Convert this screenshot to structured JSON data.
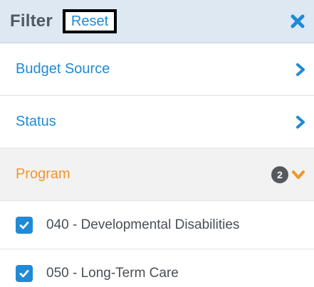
{
  "header": {
    "title": "Filter",
    "reset_label": "Reset",
    "close_icon": "close-icon"
  },
  "sections": [
    {
      "label": "Budget Source",
      "state": "collapsed",
      "icon": "chevron-right-icon"
    },
    {
      "label": "Status",
      "state": "collapsed",
      "icon": "chevron-right-icon"
    },
    {
      "label": "Program",
      "state": "expanded",
      "icon": "chevron-down-icon",
      "selected_count": "2"
    }
  ],
  "program_options": [
    {
      "label": "040 - Developmental Disabilities",
      "checked": true
    },
    {
      "label": "050 - Long-Term Care",
      "checked": true
    }
  ],
  "colors": {
    "accent": "#1f8ad6",
    "active_section": "#f0962b",
    "header_bg": "#dde8f2",
    "badge_bg": "#55595e"
  }
}
